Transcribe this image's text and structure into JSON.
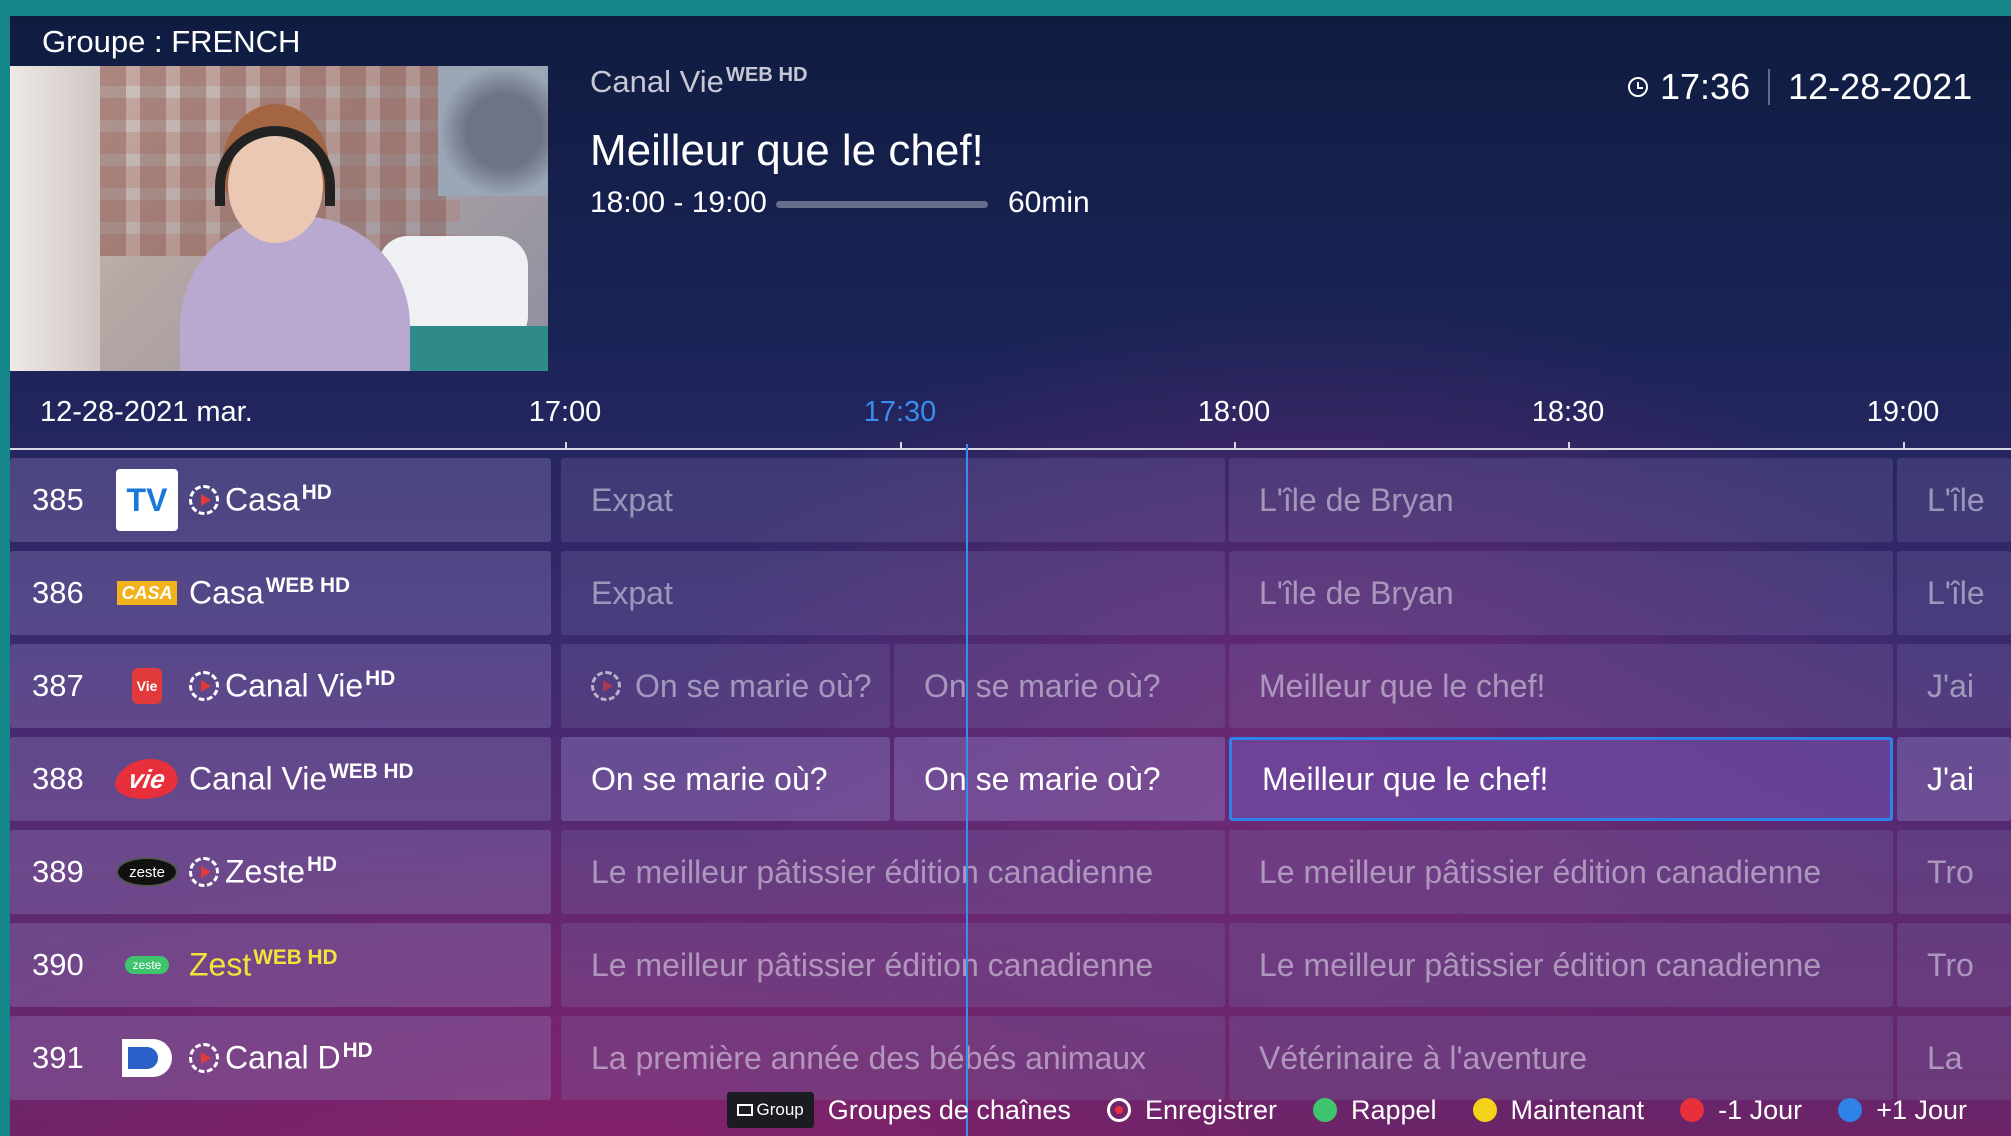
{
  "header": {
    "group_label": "Groupe : FRENCH",
    "channel_name": "Canal Vie",
    "channel_badge": "WEB HD",
    "program_title": "Meilleur que le chef!",
    "program_time": "18:00 - 19:00",
    "progress_fraction": 0,
    "duration": "60min",
    "clock_time": "17:36",
    "clock_date": "12-28-2021"
  },
  "timeline": {
    "date_label": "12-28-2021 mar.",
    "ticks": [
      "17:00",
      "17:30",
      "18:00",
      "18:30",
      "19:00"
    ],
    "current_tick": "17:30"
  },
  "channels": [
    {
      "number": "385",
      "logo": "TV",
      "name": "Casa",
      "badge": "HD",
      "catchup": true,
      "programs": [
        "Expat",
        "L'île de Bryan",
        "L'île"
      ]
    },
    {
      "number": "386",
      "logo": "CASA",
      "name": "Casa",
      "badge": "WEB HD",
      "catchup": false,
      "programs": [
        "Expat",
        "L'île de Bryan",
        "L'île"
      ]
    },
    {
      "number": "387",
      "logo": "Vie",
      "name": "Canal Vie",
      "badge": "HD",
      "catchup": true,
      "programs": [
        "On se marie où?",
        "On se marie où?",
        "Meilleur que le chef!",
        "J'ai"
      ]
    },
    {
      "number": "388",
      "logo": "vie",
      "name": "Canal Vie",
      "badge": "WEB HD",
      "catchup": false,
      "programs": [
        "On se marie où?",
        "On se marie où?",
        "Meilleur que le chef!",
        "J'ai"
      ]
    },
    {
      "number": "389",
      "logo": "zeste",
      "name": "Zeste",
      "badge": "HD",
      "catchup": true,
      "programs": [
        "Le meilleur pâtissier édition canadienne",
        "Le meilleur pâtissier édition canadienne",
        "Tro"
      ]
    },
    {
      "number": "390",
      "logo": "zeste",
      "name": "Zest",
      "badge": "WEB HD",
      "catchup": false,
      "programs": [
        "Le meilleur pâtissier édition canadienne",
        "Le meilleur pâtissier édition canadienne",
        "Tro"
      ]
    },
    {
      "number": "391",
      "logo": "D",
      "name": "Canal D",
      "badge": "HD",
      "catchup": true,
      "programs": [
        "La première année des bébés animaux",
        "Vétérinaire à l'aventure",
        "La"
      ]
    }
  ],
  "footer": {
    "group_button": "Group",
    "groups_label": "Groupes de chaînes",
    "record_label": "Enregistrer",
    "reminder_label": "Rappel",
    "now_label": "Maintenant",
    "prev_day_label": "-1 Jour",
    "next_day_label": "+1 Jour"
  },
  "colors": {
    "accent_blue": "#2f82e8",
    "green": "#3ec46d",
    "yellow": "#f5d21a",
    "red": "#e8303c",
    "blue": "#2f82e8"
  }
}
